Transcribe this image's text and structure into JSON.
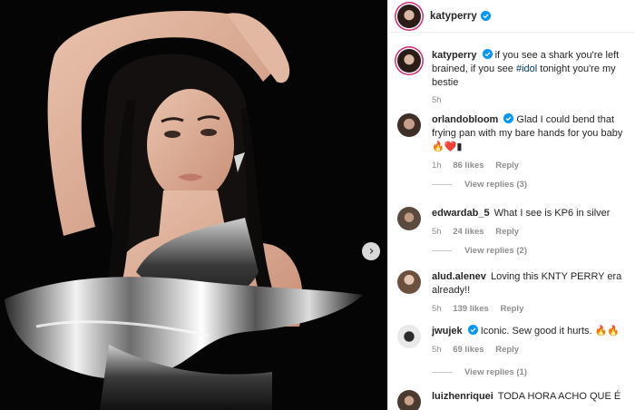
{
  "post": {
    "author": "katyperry",
    "next_icon": "chevron-right-icon",
    "caption_prefix": "if you see a shark you're left brained, if you see ",
    "caption_hashtag": "#idol",
    "caption_suffix": " tonight you're my bestie",
    "caption_time": "5h"
  },
  "comments": [
    {
      "user": "orlandobloom",
      "verified": true,
      "text": "Glad I could bend that frying pan with my bare hands for you baby 🔥❤️▮",
      "time": "1h",
      "likes": "86 likes",
      "reply": "Reply",
      "view_replies": "View replies (3)"
    },
    {
      "user": "edwardab_5",
      "verified": false,
      "text": "What I see is KP6 in silver",
      "time": "5h",
      "likes": "24 likes",
      "reply": "Reply",
      "view_replies": "View replies (2)"
    },
    {
      "user": "alud.alenev",
      "verified": false,
      "text": "Loving this KNTY PERRY era already!!",
      "time": "5h",
      "likes": "139 likes",
      "reply": "Reply",
      "view_replies": ""
    },
    {
      "user": "jwujek",
      "verified": true,
      "text": "Iconic. Sew good it hurts. 🔥🔥",
      "time": "5h",
      "likes": "69 likes",
      "reply": "Reply",
      "view_replies": "View replies (1)"
    },
    {
      "user": "luizhenriquei",
      "verified": false,
      "text": "TODA HORA ACHO QUE É",
      "time": "",
      "likes": "",
      "reply": "",
      "view_replies": ""
    }
  ],
  "colors": {
    "verified": "#0095f6",
    "hashtag": "#00376b",
    "muted": "#8e8e8e"
  }
}
